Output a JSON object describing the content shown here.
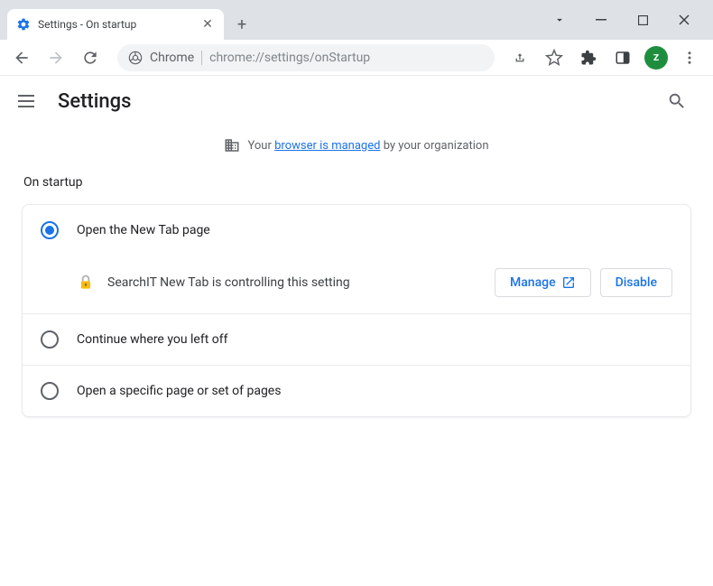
{
  "window": {
    "tab_title": "Settings - On startup"
  },
  "addressbar": {
    "prefix": "Chrome",
    "url": "chrome://settings/onStartup"
  },
  "avatar": {
    "initial": "z",
    "color": "#1e8e3e"
  },
  "settings": {
    "title": "Settings",
    "managed_prefix": "Your",
    "managed_link": "browser is managed",
    "managed_suffix": "by your organization",
    "section_label": "On startup",
    "options": [
      {
        "label": "Open the New Tab page",
        "selected": true
      },
      {
        "label": "Continue where you left off",
        "selected": false
      },
      {
        "label": "Open a specific page or set of pages",
        "selected": false
      }
    ],
    "controlled": {
      "text": "SearchIT New Tab is controlling this setting",
      "manage_label": "Manage",
      "disable_label": "Disable"
    }
  }
}
